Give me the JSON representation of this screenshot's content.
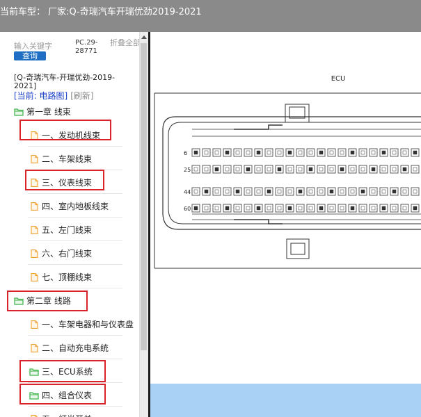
{
  "window": {
    "title": "当前车型： 厂家:Q-奇瑞汽车开瑞优劲2019-2021"
  },
  "search": {
    "placeholder": "输入关键字",
    "button_label": "查询"
  },
  "pc_code": "PC.29-28771",
  "collapse_label": "折叠全部",
  "breadcrumb": {
    "path": "[Q-奇瑞汽车-开瑞优劲-2019-2021]",
    "current": "[当前: 电路图]",
    "refresh": "[刷新]"
  },
  "tree": [
    {
      "label": "第一章 线束",
      "type": "folder",
      "level": 0,
      "highlighted": false
    },
    {
      "label": "一、发动机线束",
      "type": "file",
      "level": 1,
      "highlighted": true
    },
    {
      "label": "二、车架线束",
      "type": "file",
      "level": 1,
      "highlighted": false
    },
    {
      "label": "三、仪表线束",
      "type": "file",
      "level": 1,
      "highlighted": true
    },
    {
      "label": "四、室内地板线束",
      "type": "file",
      "level": 1,
      "highlighted": false
    },
    {
      "label": "五、左门线束",
      "type": "file",
      "level": 1,
      "highlighted": false
    },
    {
      "label": "六、右门线束",
      "type": "file",
      "level": 1,
      "highlighted": false
    },
    {
      "label": "七、顶棚线束",
      "type": "file",
      "level": 1,
      "highlighted": false
    },
    {
      "label": "第二章 线路",
      "type": "folder",
      "level": 0,
      "highlighted": true
    },
    {
      "label": "一、车架电器和与仪表盘",
      "type": "file",
      "level": 1,
      "highlighted": false
    },
    {
      "label": "二、自动充电系统",
      "type": "file",
      "level": 1,
      "highlighted": false
    },
    {
      "label": "三、ECU系统",
      "type": "folder",
      "level": 1,
      "highlighted": true
    },
    {
      "label": "四、组合仪表",
      "type": "folder",
      "level": 1,
      "highlighted": true
    },
    {
      "label": "五、灯光开关",
      "type": "file",
      "level": 1,
      "highlighted": false
    }
  ],
  "diagram": {
    "title": "ECU",
    "row_labels": [
      "6",
      "25",
      "44",
      "60"
    ]
  },
  "colors": {
    "titlebar": "#8a8a8a",
    "highlight": "#d9232a",
    "folder": "#3bb24a",
    "file": "#f0a030",
    "query_button": "#1e6fc4",
    "viewer_footer": "#a9d0f5"
  },
  "icons": {
    "folder": "folder-icon",
    "file": "file-icon"
  }
}
